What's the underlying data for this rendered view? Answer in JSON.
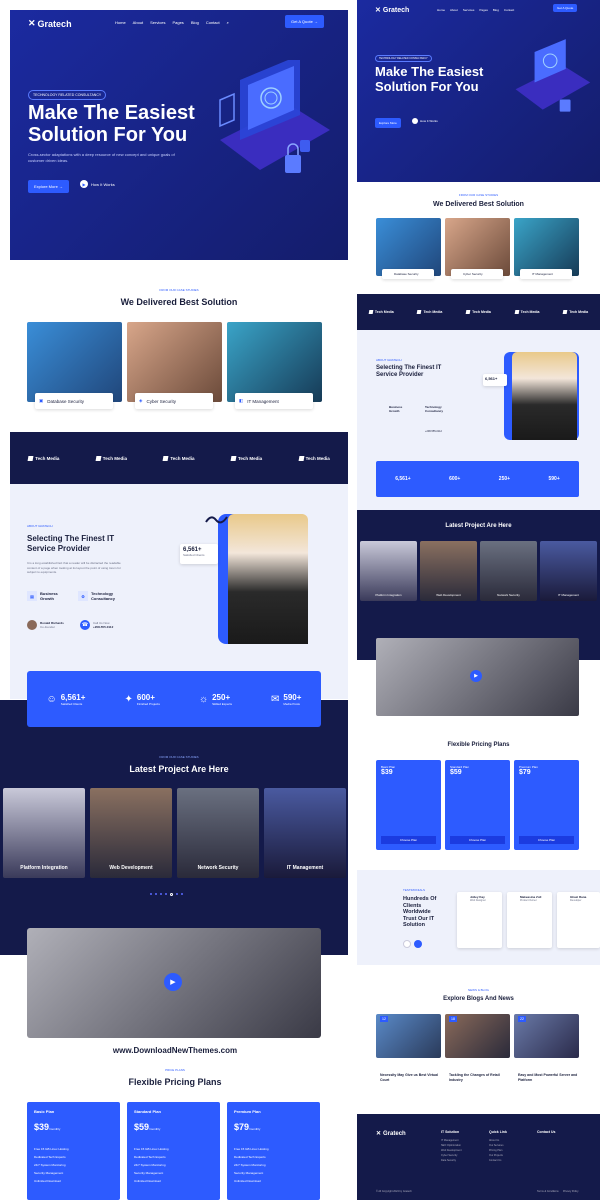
{
  "brand": {
    "name": "Gratech"
  },
  "nav": {
    "items": [
      "Home",
      "About",
      "Services",
      "Pages",
      "Blog",
      "Contact"
    ],
    "cta": "Get A Quote"
  },
  "hero": {
    "tag": "TECHNOLOGY RELATED CONSULTANCY",
    "title_line1": "Make The Easiest",
    "title_line2": "Solution For You",
    "desc": "Cross-sector adaptations with a deep resource of new concept and unique goals of customer driven ideas.",
    "btn_primary": "Explore More",
    "btn_secondary": "How It Works"
  },
  "cases": {
    "tag": "FROM OUR CASE STUDIES",
    "title": "We Delivered Best Solution",
    "items": [
      "Database Security",
      "Cyber Security",
      "IT Management"
    ]
  },
  "partners": [
    "Tech Media",
    "Tech Media",
    "Tech Media",
    "Tech Media",
    "Tech Media"
  ],
  "about": {
    "tag": "ABOUT GRATECH",
    "title_line1": "Selecting The Finest IT",
    "title_line2": "Service Provider",
    "desc": "It is a long established fact that a reader will be distracted the readable content of a page when looking at its layout the point of using lorem for subject to equipments.",
    "feat1": "Business Growth",
    "feat2": "Technology Consultancy",
    "author": "Ronald Richards",
    "author_role": "Co-founder",
    "call_label": "Call Us Now",
    "phone": "+208-555-0112",
    "badge_num": "6,561+",
    "badge_label": "Satisfied Clients"
  },
  "stats": [
    {
      "num": "6,561+",
      "label": "Satisfied Clients"
    },
    {
      "num": "600+",
      "label": "Finished Projects"
    },
    {
      "num": "250+",
      "label": "Skilled Experts"
    },
    {
      "num": "590+",
      "label": "Media Posts"
    }
  ],
  "projects": {
    "tag": "FROM OUR CASE STUDIES",
    "title": "Latest Project Are Here",
    "items": [
      "Platform Integration",
      "Web Development",
      "Network Security",
      "IT Management"
    ]
  },
  "watermark": "www.DownloadNewThemes.com",
  "pricing": {
    "tag": "PRICE PLANS",
    "title": "Flexible Pricing Plans",
    "plans": [
      {
        "name": "Basic Plan",
        "price": "$39",
        "per": "/monthly"
      },
      {
        "name": "Standard Plan",
        "price": "$59",
        "per": "/monthly"
      },
      {
        "name": "Premium Plan",
        "price": "$79",
        "per": "/monthly"
      }
    ],
    "features": [
      "Free 15 GB Linux Hosting",
      "Dedicated Tech Experts",
      "24/7 System Monitoring",
      "Security Management",
      "Unlimited Download"
    ],
    "btn": "Choose Plan"
  },
  "testimonials": {
    "tag": "TESTIMONIALS",
    "title_lines": [
      "Hundreds Of",
      "Clients",
      "Worldwide",
      "Trust Our IT",
      "Solution"
    ],
    "people": [
      {
        "name": "Jolley Kay",
        "role": "Web Designer"
      },
      {
        "name": "Makeasina Zoll",
        "role": "Product Owner"
      },
      {
        "name": "Ghazi Rana",
        "role": "Developer"
      }
    ]
  },
  "blog": {
    "tag": "NEWS & BLOG",
    "title": "Explore Blogs And News",
    "posts": [
      {
        "day": "12",
        "title": "Necessity May Give us Best Virtual Court"
      },
      {
        "day": "18",
        "title": "Tackling the Changes of Retail Industry"
      },
      {
        "day": "22",
        "title": "Easy and Most Powerful Server and Platform"
      }
    ]
  },
  "footer": {
    "col1": "IT Solution",
    "col2": "Quick Link",
    "col3": "Contact Us",
    "solutions": [
      "IT Management",
      "SEO Optimization",
      "Web Development",
      "Cyber Security",
      "Data Security"
    ],
    "links": [
      "About Us",
      "Our Services",
      "Pricing Plan",
      "Our Projects",
      "Contact Us"
    ],
    "copyright": "© All Copyright 2024 by Gratech",
    "terms": "Terms & Conditions",
    "privacy": "Privacy Policy"
  }
}
